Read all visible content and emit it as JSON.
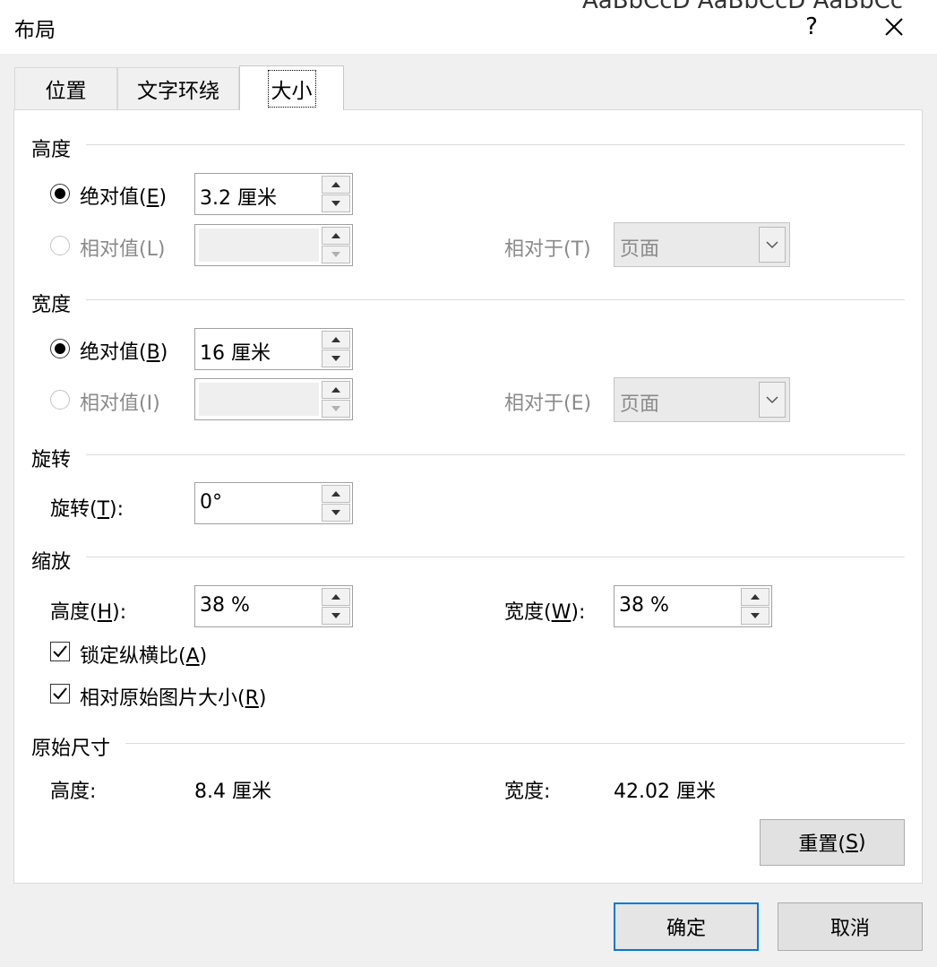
{
  "window": {
    "title": "布局",
    "help_label": "?"
  },
  "background_fragment": "AaBbCcD AaBbCcD AaBbCc",
  "tabs": [
    {
      "label": "位置",
      "active": false
    },
    {
      "label": "文字环绕",
      "active": false
    },
    {
      "label": "大小",
      "active": true
    }
  ],
  "height_section": {
    "title": "高度",
    "absolute": {
      "label": "绝对值(",
      "key": "E",
      "close": ")",
      "value": "3.2 厘米",
      "checked": true
    },
    "relative": {
      "label": "相对值(L)",
      "value": "",
      "disabled": true
    },
    "relative_to": {
      "label": "相对于(T)",
      "value": "页面",
      "disabled": true
    }
  },
  "width_section": {
    "title": "宽度",
    "absolute": {
      "label": "绝对值(",
      "key": "B",
      "close": ")",
      "value": "16 厘米",
      "checked": true
    },
    "relative": {
      "label": "相对值(I)",
      "value": "",
      "disabled": true
    },
    "relative_to": {
      "label": "相对于(E)",
      "value": "页面",
      "disabled": true
    }
  },
  "rotation_section": {
    "title": "旋转",
    "rotation": {
      "label": "旋转(",
      "key": "T",
      "close": "):",
      "value": "0°"
    }
  },
  "scale_section": {
    "title": "缩放",
    "height": {
      "label": "高度(",
      "key": "H",
      "close": "):",
      "value": "38 %"
    },
    "width": {
      "label": "宽度(",
      "key": "W",
      "close": "):",
      "value": "38 %"
    },
    "lock_aspect": {
      "label": "锁定纵横比(",
      "key": "A",
      "close": ")",
      "checked": true
    },
    "relative_original": {
      "label": "相对原始图片大小(",
      "key": "R",
      "close": ")",
      "checked": true
    }
  },
  "original_size_section": {
    "title": "原始尺寸",
    "height_label": "高度:",
    "height_value": "8.4 厘米",
    "width_label": "宽度:",
    "width_value": "42.02 厘米"
  },
  "reset_button": {
    "label": "重置(",
    "key": "S",
    "close": ")"
  },
  "ok_button": {
    "label": "确定"
  },
  "cancel_button": {
    "label": "取消"
  },
  "colors": {
    "accent": "#0078d7",
    "panel_bg": "#ffffff",
    "window_bg": "#f0f0f0",
    "disabled_text": "#8a8a8a"
  },
  "icons": [
    "close-icon",
    "spin-up-icon",
    "spin-down-icon",
    "chevron-down-icon",
    "checkmark-icon"
  ]
}
